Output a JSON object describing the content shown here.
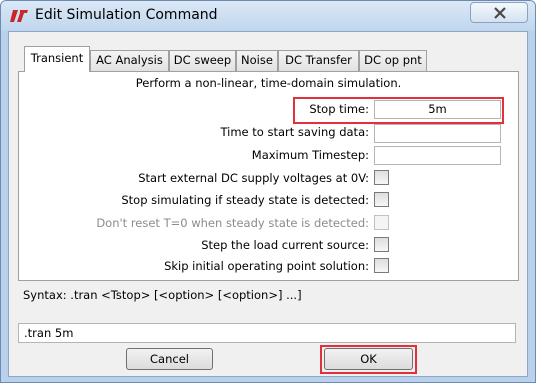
{
  "window": {
    "title": "Edit Simulation Command"
  },
  "tabs": [
    {
      "label": "Transient"
    },
    {
      "label": "AC Analysis"
    },
    {
      "label": "DC sweep"
    },
    {
      "label": "Noise"
    },
    {
      "label": "DC Transfer"
    },
    {
      "label": "DC op pnt"
    }
  ],
  "transient": {
    "description": "Perform a non-linear, time-domain simulation.",
    "stop_time": {
      "label": "Stop time:",
      "value": "5m"
    },
    "start_saving": {
      "label": "Time to start saving data:",
      "value": ""
    },
    "max_timestep": {
      "label": "Maximum Timestep:",
      "value": ""
    },
    "options": [
      {
        "label": "Start external DC supply voltages at 0V:",
        "checked": false,
        "enabled": true
      },
      {
        "label": "Stop simulating if steady state is detected:",
        "checked": false,
        "enabled": true
      },
      {
        "label": "Don't reset T=0 when steady state is detected:",
        "checked": false,
        "enabled": false
      },
      {
        "label": "Step the load current source:",
        "checked": false,
        "enabled": true
      },
      {
        "label": "Skip initial operating point solution:",
        "checked": false,
        "enabled": true
      }
    ]
  },
  "syntax": "Syntax:  .tran <Tstop> [<option> [<option>] ...]",
  "command": {
    "value": ".tran 5m"
  },
  "buttons": {
    "cancel": "Cancel",
    "ok": "OK"
  },
  "colors": {
    "highlight": "#e0323c",
    "title_bar": "#c0d6ee"
  }
}
